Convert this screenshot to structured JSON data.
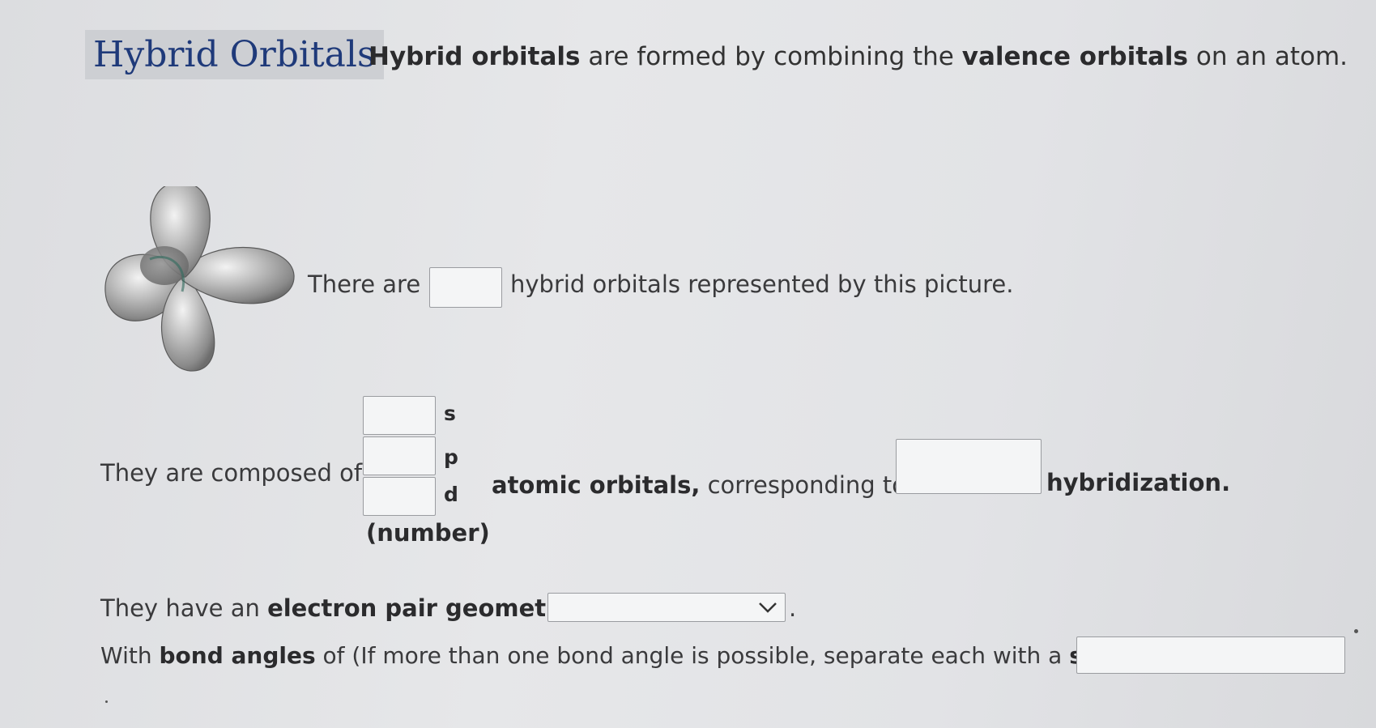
{
  "header": {
    "title": "Hybrid Orbitals",
    "intro_bold_1": "Hybrid orbitals",
    "intro_text_1": " are formed by combining the ",
    "intro_bold_2": "valence orbitals",
    "intro_text_2": " on an atom."
  },
  "figure": {
    "icon": "tetrahedral-hybrid-orbitals-image"
  },
  "question1": {
    "prefix": "There are",
    "suffix": "hybrid orbitals represented by this picture.",
    "answer": "",
    "placeholder": ""
  },
  "question2": {
    "prefix": "They are composed of",
    "labels": [
      "s",
      "p",
      "d"
    ],
    "values": [
      "",
      "",
      ""
    ],
    "number_label": "(number)",
    "middle_bold": "atomic orbitals,",
    "middle_text": " corresponding to",
    "hybridization_value": "",
    "suffix": "hybridization."
  },
  "question3": {
    "prefix": "They have an ",
    "prefix_bold": "electron pair geometry of",
    "selected": "",
    "suffix": "."
  },
  "question4": {
    "text_1": "With ",
    "bold_1": "bond angles",
    "text_2": " of (If more than one bond angle is possible, separate each with a ",
    "bold_2": "space",
    "text_3": ").",
    "answer": ""
  }
}
